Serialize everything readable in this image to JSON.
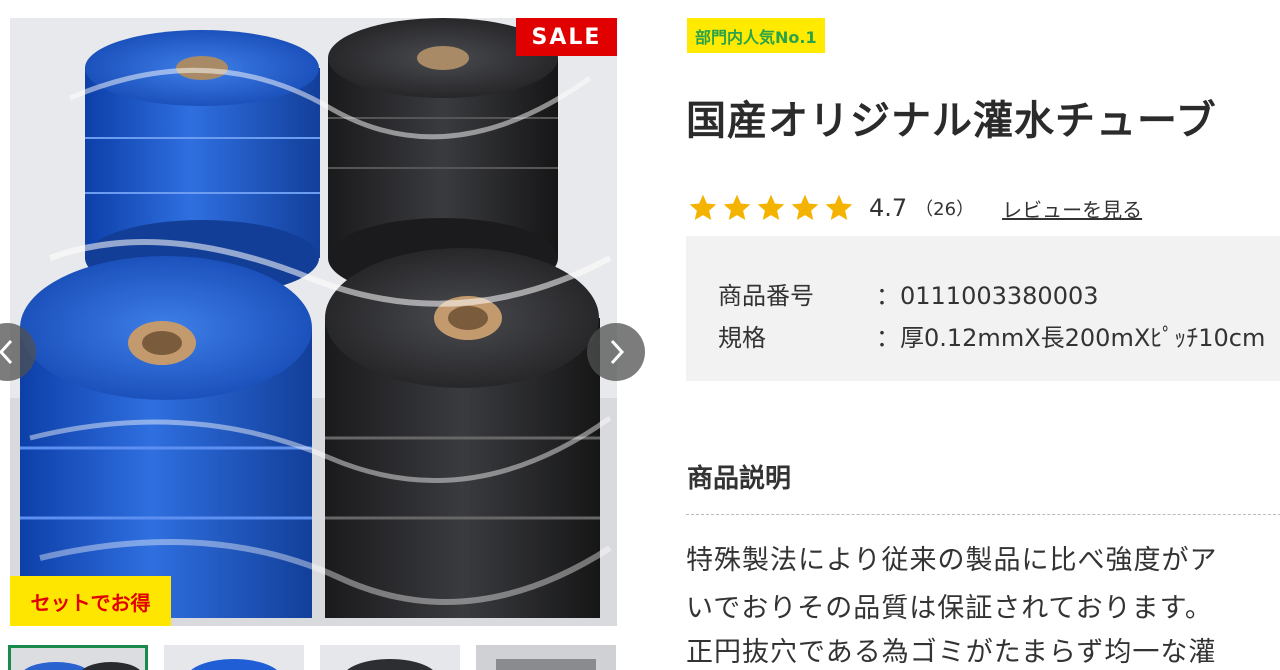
{
  "gallery": {
    "sale_badge": "SALE",
    "set_badge": "セットでお得",
    "prev_icon": "chevron-left-icon",
    "next_icon": "chevron-right-icon",
    "colors": {
      "sale_bg": "#e00000",
      "set_bg": "#ffe600",
      "thumb_active_border": "#1a8a4a"
    }
  },
  "product": {
    "rank_badge": "部門内人気No.1",
    "title": "国産オリジナル灌水チューブ",
    "rating": {
      "stars": 5,
      "value": "4.7",
      "count": "（26）",
      "review_link": "レビューを見る",
      "star_color": "#f5b301"
    },
    "specs": [
      {
        "label": "商品番号",
        "value": "：0111003380003"
      },
      {
        "label": "規格",
        "value": "：厚0.12mmX長200mXﾋﾟｯﾁ10cm"
      }
    ],
    "description": {
      "heading": "商品説明",
      "lines": [
        "特殊製法により従来の製品に比べ強度がア",
        "いでおりその品質は保証されております。",
        "正円抜穴である為ゴミがたまらず均一な灌"
      ]
    }
  }
}
